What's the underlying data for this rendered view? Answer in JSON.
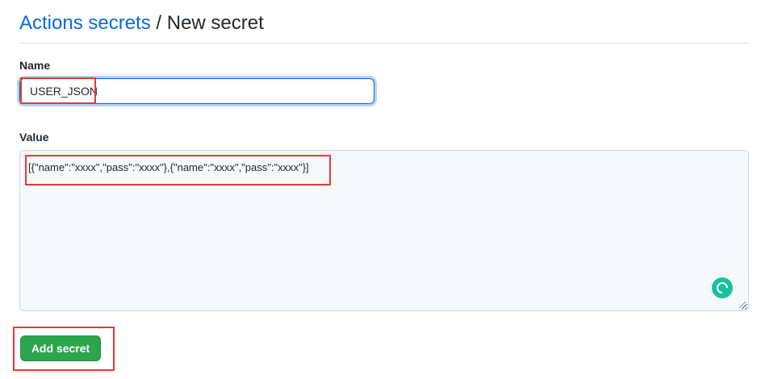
{
  "header": {
    "breadcrumb_link": "Actions secrets",
    "separator": " / ",
    "current": "New secret"
  },
  "form": {
    "name_label": "Name",
    "name_value": "USER_JSON",
    "value_label": "Value",
    "value_text": "[{\"name\":\"xxxx\",\"pass\":\"xxxx\"},{\"name\":\"xxxx\",\"pass\":\"xxxx\"}]",
    "submit_label": "Add secret"
  },
  "icons": {
    "grammarly": "grammarly-icon",
    "resize": "resize-handle-icon"
  },
  "colors": {
    "link": "#0969da",
    "button": "#2da44e",
    "highlight": "#e53935",
    "grammarly": "#15c39a"
  }
}
